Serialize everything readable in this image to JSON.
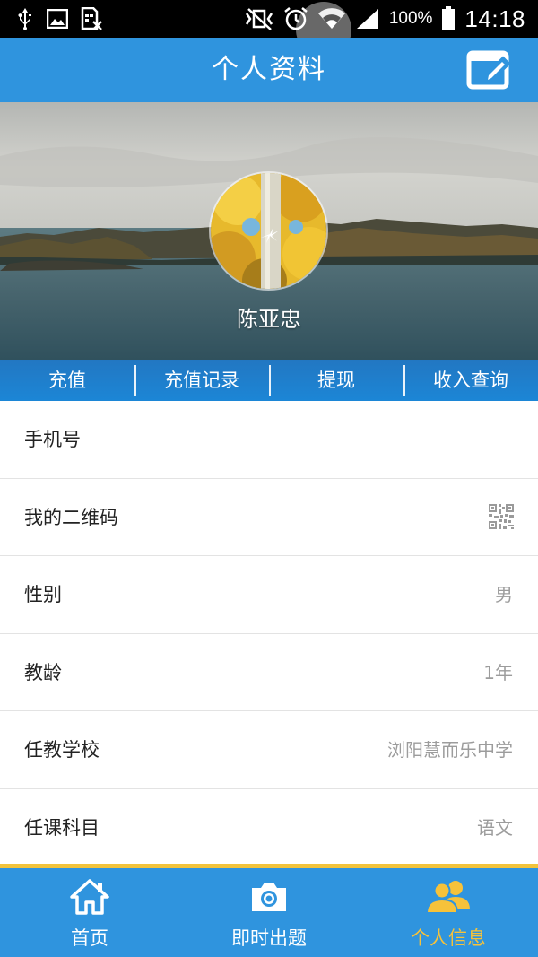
{
  "status_bar": {
    "time": "14:18",
    "battery_percent": "100%",
    "icons_left": [
      "usb-icon",
      "image-icon",
      "sim-off-icon"
    ],
    "icons_right": [
      "vibrate-off-icon",
      "alarm-icon",
      "wifi-icon",
      "signal-icon",
      "battery-icon"
    ]
  },
  "header": {
    "title": "个人资料",
    "edit_icon": "edit-icon"
  },
  "profile": {
    "name": "陈亚忠",
    "actions": [
      {
        "label": "充值"
      },
      {
        "label": "充值记录"
      },
      {
        "label": "提现"
      },
      {
        "label": "收入查询"
      }
    ]
  },
  "info": {
    "phone": {
      "label": "手机号",
      "value": ""
    },
    "qrcode": {
      "label": "我的二维码",
      "icon": "qr-code-icon"
    },
    "gender": {
      "label": "性别",
      "value": "男"
    },
    "teaching_years": {
      "label": "教龄",
      "value": "1年"
    },
    "school": {
      "label": "任教学校",
      "value": "浏阳慧而乐中学"
    },
    "subject": {
      "label": "任课科目",
      "value": "语文"
    }
  },
  "bottom_nav": {
    "items": [
      {
        "label": "首页",
        "icon": "home-icon"
      },
      {
        "label": "即时出题",
        "icon": "camera-icon"
      },
      {
        "label": "个人信息",
        "icon": "users-icon",
        "active": true
      }
    ]
  },
  "colors": {
    "primary": "#2f94de",
    "active_tab": "#f6c23a",
    "value_text": "#9c9c9c"
  }
}
